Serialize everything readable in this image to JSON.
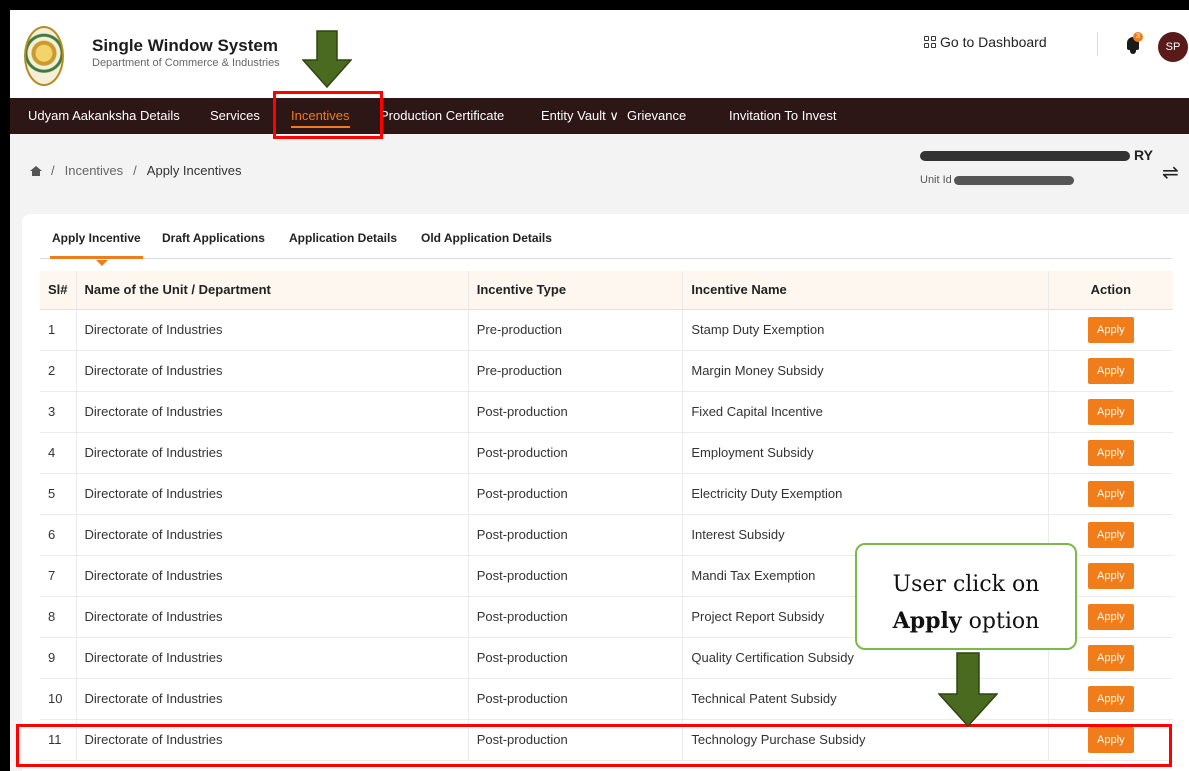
{
  "header": {
    "title": "Single Window System",
    "subtitle": "Department of Commerce & Industries",
    "dashboard_link": "Go to Dashboard",
    "notification_count": "3",
    "avatar_initials": "SP"
  },
  "nav": {
    "items": [
      {
        "label": "Udyam Aakanksha Details"
      },
      {
        "label": "Services"
      },
      {
        "label": "Incentives"
      },
      {
        "label": "Production Certificate"
      },
      {
        "label": "Entity Vault"
      },
      {
        "label": "Grievance"
      },
      {
        "label": "Invitation To Invest"
      }
    ],
    "active": "Incentives",
    "dropdown_glyph": "∨"
  },
  "breadcrumb": {
    "items": [
      "Incentives",
      "Apply Incentives"
    ],
    "separator": "/"
  },
  "unit": {
    "name_tail": "RY",
    "id_label": "Unit Id"
  },
  "tabs": [
    {
      "label": "Apply Incentive"
    },
    {
      "label": "Draft Applications"
    },
    {
      "label": "Application Details"
    },
    {
      "label": "Old Application Details"
    }
  ],
  "table": {
    "columns": [
      "Sl#",
      "Name of the Unit / Department",
      "Incentive Type",
      "Incentive Name",
      "Action"
    ],
    "rows": [
      {
        "sl": "1",
        "unit": "Directorate of Industries",
        "type": "Pre-production",
        "name": "Stamp Duty Exemption",
        "action": "Apply"
      },
      {
        "sl": "2",
        "unit": "Directorate of Industries",
        "type": "Pre-production",
        "name": "Margin Money Subsidy",
        "action": "Apply"
      },
      {
        "sl": "3",
        "unit": "Directorate of Industries",
        "type": "Post-production",
        "name": "Fixed Capital Incentive",
        "action": "Apply"
      },
      {
        "sl": "4",
        "unit": "Directorate of Industries",
        "type": "Post-production",
        "name": "Employment Subsidy",
        "action": "Apply"
      },
      {
        "sl": "5",
        "unit": "Directorate of Industries",
        "type": "Post-production",
        "name": "Electricity Duty Exemption",
        "action": "Apply"
      },
      {
        "sl": "6",
        "unit": "Directorate of Industries",
        "type": "Post-production",
        "name": "Interest Subsidy",
        "action": "Apply"
      },
      {
        "sl": "7",
        "unit": "Directorate of Industries",
        "type": "Post-production",
        "name": "Mandi Tax Exemption",
        "action": "Apply"
      },
      {
        "sl": "8",
        "unit": "Directorate of Industries",
        "type": "Post-production",
        "name": "Project Report Subsidy",
        "action": "Apply"
      },
      {
        "sl": "9",
        "unit": "Directorate of Industries",
        "type": "Post-production",
        "name": "Quality Certification Subsidy",
        "action": "Apply"
      },
      {
        "sl": "10",
        "unit": "Directorate of Industries",
        "type": "Post-production",
        "name": "Technical Patent Subsidy",
        "action": "Apply"
      },
      {
        "sl": "11",
        "unit": "Directorate of Industries",
        "type": "Post-production",
        "name": "Technology Purchase Subsidy",
        "action": "Apply"
      }
    ]
  },
  "callout": {
    "line1": "User click on",
    "bold": "Apply",
    "line2_rest": " option"
  },
  "icons": {
    "home": "home-icon",
    "bell": "bell-icon",
    "grid": "grid-icon",
    "swap": "swap-arrows-icon"
  },
  "colors": {
    "accent": "#f07d1a",
    "nav_bg": "#2d1616",
    "highlight": "#ff0000",
    "arrow": "#4a6b1f",
    "callout_border": "#7fb84a"
  }
}
